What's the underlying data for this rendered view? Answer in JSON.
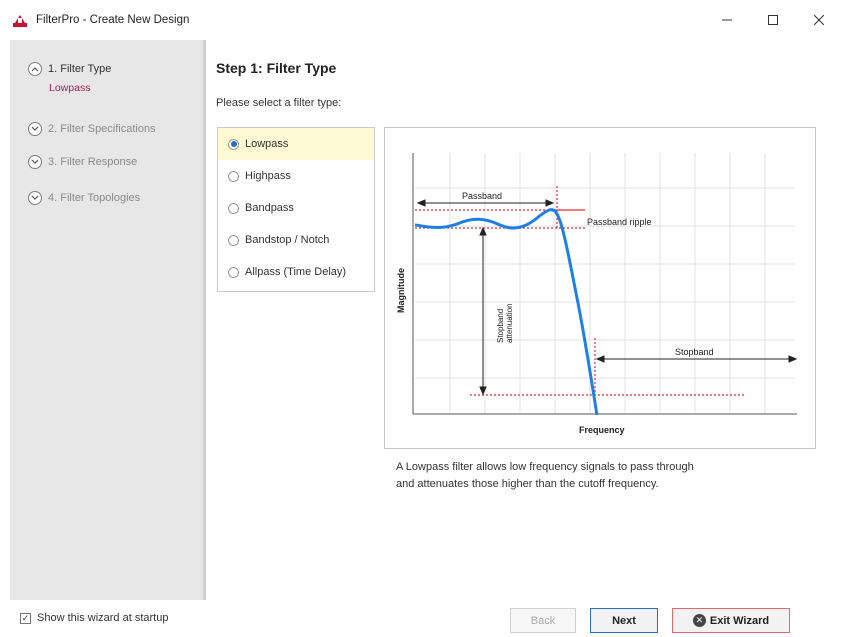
{
  "window": {
    "title": "FilterPro - Create New Design",
    "minimize_icon": "minimize-icon",
    "maximize_icon": "maximize-icon",
    "close_icon": "close-icon"
  },
  "sidebar": {
    "steps": [
      {
        "label": "1. Filter Type",
        "sub": "Lowpass",
        "state": "active",
        "icon": "chevron-up-icon"
      },
      {
        "label": "2. Filter Specifications",
        "state": "inactive",
        "icon": "chevron-down-icon"
      },
      {
        "label": "3. Filter Response",
        "state": "inactive",
        "icon": "chevron-down-icon"
      },
      {
        "label": "4. Filter Topologies",
        "state": "inactive",
        "icon": "chevron-down-icon"
      }
    ]
  },
  "main": {
    "step_title": "Step 1: Filter Type",
    "prompt": "Please select a filter type:",
    "filter_types": [
      {
        "label": "Lowpass",
        "selected": true
      },
      {
        "label": "Highpass",
        "selected": false
      },
      {
        "label": "Bandpass",
        "selected": false
      },
      {
        "label": "Bandstop / Notch",
        "selected": false
      },
      {
        "label": "Allpass (Time Delay)",
        "selected": false
      }
    ],
    "diagram": {
      "ylabel": "Magnitude",
      "xlabel": "Frequency",
      "passband_label": "Passband",
      "ripple_label": "Passband ripple",
      "stopband_label": "Stopband",
      "atten_line1": "Stopband",
      "atten_line2": "attenuation"
    },
    "description_line1": "A Lowpass filter allows low frequency signals to pass through",
    "description_line2": "and attenuates those higher than the cutoff frequency."
  },
  "footer": {
    "show_wizard_label": "Show this wizard at startup",
    "show_wizard_checked": true,
    "back_label": "Back",
    "next_label": "Next",
    "exit_label": "Exit Wizard"
  },
  "colors": {
    "accent": "#2c6bc2",
    "curve": "#1e7fe6",
    "sub_label": "#b0205a",
    "selected_bg": "#fcf9d3",
    "guide_red": "#e03030"
  }
}
